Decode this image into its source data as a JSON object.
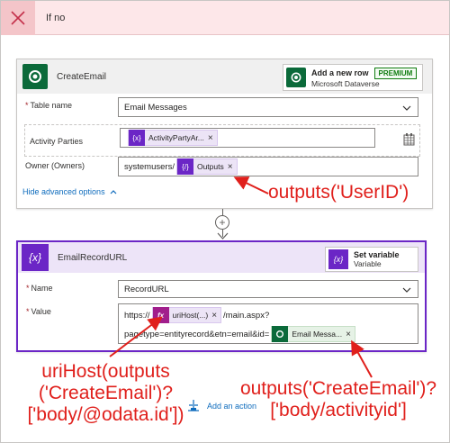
{
  "ifno": {
    "title": "If no"
  },
  "create_email": {
    "title": "CreateEmail",
    "operation": {
      "title": "Add a new row",
      "badge": "PREMIUM",
      "connector": "Microsoft Dataverse"
    },
    "table_label": "Table name",
    "table_value": "Email Messages",
    "activity_label": "Activity Parties",
    "activity_token": "ActivityPartyAr...",
    "owner_label": "Owner (Owners)",
    "owner_prefix": "systemusers/",
    "owner_token": "Outputs",
    "hide_advanced": "Hide advanced options"
  },
  "email_record": {
    "title": "EmailRecordURL",
    "operation": {
      "title": "Set variable",
      "connector": "Variable"
    },
    "name_label": "Name",
    "name_value": "RecordURL",
    "value_label": "Value",
    "value_line1_prefix": "https://",
    "value_token_fx": "uriHost(...)",
    "value_line1_suffix": "/main.aspx?",
    "value_line2_prefix": "pagetype=entityrecord&etn=email&id=",
    "value_token_email": "Email Messa..."
  },
  "add_action": "Add an action",
  "annotations": {
    "userid": "outputs('UserID')",
    "urihost_1": "uriHost(outputs",
    "urihost_2": "('CreateEmail')?",
    "urihost_3": "['body/@odata.id'])",
    "activityid_1": "outputs('CreateEmail')?",
    "activityid_2": "['body/activityid']"
  },
  "colors": {
    "annotation": "#e0201c",
    "variable": "#6b26c6",
    "dataverse": "#0b6a3a",
    "fx": "#a11e8c"
  }
}
